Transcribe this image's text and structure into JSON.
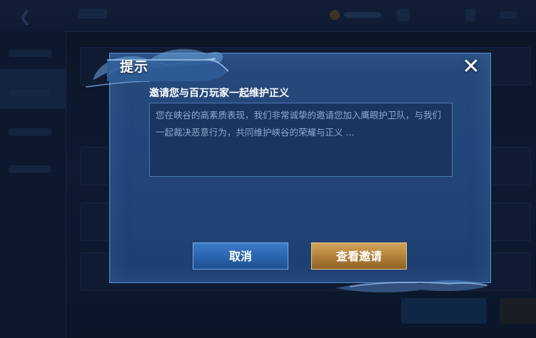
{
  "dialog": {
    "title": "提示",
    "close_symbol": "✕",
    "subtitle": "邀请您与百万玩家一起维护正义",
    "message": "您在峡谷的高素质表现，我们非常诚挚的邀请您加入鹰眼护卫队，与我们一起裁决恶意行为，共同维护峡谷的荣耀与正义 ...",
    "cancel_label": "取消",
    "view_label": "查看邀请"
  },
  "colors": {
    "dialog_bg": "#23467a",
    "dialog_border": "#5b8fd0",
    "cancel_button": "#2a63ad",
    "view_button": "#b07e38",
    "message_text": "#8fa9cc"
  },
  "icons": {
    "close": "close-icon",
    "back": "back-arrow-icon"
  }
}
